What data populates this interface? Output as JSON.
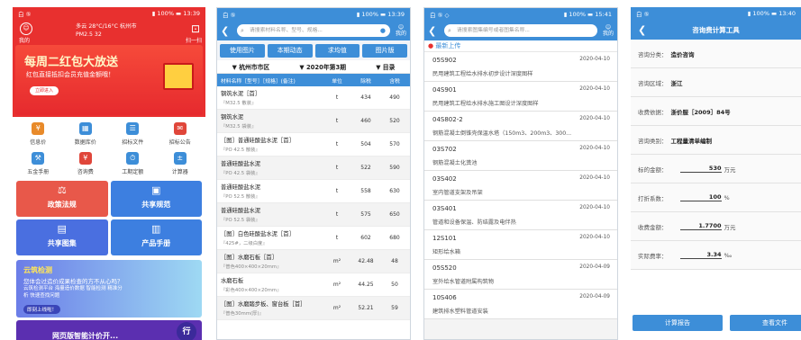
{
  "phone1": {
    "status_left": "白 ⑤",
    "status_right": "▮ 100% ▬ 13:39",
    "user_label": "我的",
    "weather": "多云 28°C/16°C  杭州市",
    "air": "PM2.5 32",
    "scan_label": "扫一扫",
    "banner_title": "每周二红包大放送",
    "banner_sub": "红包直接抵扣会员充值金额哦！",
    "banner_button": "立即进入",
    "grid": [
      {
        "label": "信息价",
        "icon": "price-info-icon",
        "color": "#e88a2a"
      },
      {
        "label": "数据库价",
        "icon": "database-icon",
        "color": "#3d8ed8"
      },
      {
        "label": "招标文件",
        "icon": "bid-file-icon",
        "color": "#3d8ed8"
      },
      {
        "label": "招标公告",
        "icon": "announcement-icon",
        "color": "#e0463a"
      },
      {
        "label": "五金手册",
        "icon": "hardware-manual-icon",
        "color": "#3d8ed8"
      },
      {
        "label": "咨询费",
        "icon": "consult-fee-icon",
        "color": "#e0463a"
      },
      {
        "label": "工期定额",
        "icon": "schedule-icon",
        "color": "#3d8ed8"
      },
      {
        "label": "计算器",
        "icon": "calculator-icon",
        "color": "#3d8ed8"
      }
    ],
    "tiles": [
      {
        "label": "政策法规",
        "color": "#e8584a"
      },
      {
        "label": "共享规范",
        "color": "#3d7fe0"
      },
      {
        "label": "共享图集",
        "color": "#4a6fe0"
      },
      {
        "label": "产品手册",
        "color": "#3d7fe0"
      }
    ],
    "ad_title": "云筑检测",
    "ad_sub": "您体会过造价成果检查的方不从心吗？",
    "ad_desc": "云筑检测平台 海量造价数据 智能检测 精准分析 快速查找问题",
    "ad_button": "即刻上线啦！",
    "ad2_text": "网页版智能计价开...",
    "fab_label": "行"
  },
  "phone2": {
    "status_left": "白 ⑤",
    "status_right": "▮ 100% ▬ 13:39",
    "search_placeholder": "请搜索材料名称、型号、规格...",
    "home_label": "我的",
    "tabs": [
      "使用图片",
      "本期动态",
      "求均值",
      "图片版"
    ],
    "filter_city": "杭州市市区",
    "filter_period": "2020年第3期",
    "filter_dir": "目录",
    "headers": [
      "材料名称［型号］［规格］(备注)",
      "单位",
      "除税",
      "含税"
    ],
    "rows": [
      {
        "name": "钢筑水泥［首］",
        "spec": "『M32.5 散装』",
        "unit": "t",
        "ex": "434",
        "inc": "490",
        "tag": true
      },
      {
        "name": "钢筑水泥",
        "spec": "『M32.5 袋装』",
        "unit": "t",
        "ex": "460",
        "inc": "520",
        "tag": false
      },
      {
        "name": "［图］普通硅酸盐水泥［首］",
        "spec": "『PO 42.5 散装』",
        "unit": "t",
        "ex": "504",
        "inc": "570",
        "tag": true
      },
      {
        "name": "普通硅酸盐水泥",
        "spec": "『PO 42.5 袋装』",
        "unit": "t",
        "ex": "522",
        "inc": "590",
        "tag": false
      },
      {
        "name": "普通硅酸盐水泥",
        "spec": "『PO 52.5 散装』",
        "unit": "t",
        "ex": "558",
        "inc": "630",
        "tag": false
      },
      {
        "name": "普通硅酸盐水泥",
        "spec": "『PO 52.5 袋装』",
        "unit": "t",
        "ex": "575",
        "inc": "650",
        "tag": false
      },
      {
        "name": "［图］白色硅酸盐水泥［首］",
        "spec": "『425#，二级白度』",
        "unit": "t",
        "ex": "602",
        "inc": "680",
        "tag": true
      },
      {
        "name": "［图］水磨石板［首］",
        "spec": "『普色400×400×20mm』",
        "unit": "m²",
        "ex": "42.48",
        "inc": "48",
        "tag": true
      },
      {
        "name": "水磨石板",
        "spec": "『彩色400×400×20mm』",
        "unit": "m²",
        "ex": "44.25",
        "inc": "50",
        "tag": false
      },
      {
        "name": "［图］水磨踏步板、窗台板［首］",
        "spec": "『普色30mm(厚)』",
        "unit": "m²",
        "ex": "52.21",
        "inc": "59",
        "tag": true
      }
    ]
  },
  "phone3": {
    "status_left": "白 ⑤ ◇",
    "status_right": "▮ 100% ▬ 15:41",
    "search_placeholder": "请搜索图集编号或者图集名称...",
    "home_label": "我的",
    "section": "最新上传",
    "items": [
      {
        "code": "05S902",
        "date": "2020-04-10",
        "title": "民用建筑工程给水排水初步设计深度图样"
      },
      {
        "code": "04S901",
        "date": "2020-04-10",
        "title": "民用建筑工程给水排水施工图设计深度图样"
      },
      {
        "code": "04S802-2",
        "date": "2020-04-10",
        "title": "钢筋混凝土倒锥壳保温水塔（150m3、200m3、300..."
      },
      {
        "code": "03S702",
        "date": "2020-04-10",
        "title": "钢筋混凝土化粪池"
      },
      {
        "code": "03S402",
        "date": "2020-04-10",
        "title": "室内管道支架及吊架"
      },
      {
        "code": "03S401",
        "date": "2020-04-10",
        "title": "管道和设备保温、防结露及电伴热"
      },
      {
        "code": "12S101",
        "date": "2020-04-10",
        "title": "矩形给水箱"
      },
      {
        "code": "05S520",
        "date": "2020-04-09",
        "title": "室外给水管道附属构筑物"
      },
      {
        "code": "10S406",
        "date": "2020-04-09",
        "title": "建筑排水塑料管道安装"
      }
    ]
  },
  "phone4": {
    "status_left": "白 ⑤",
    "status_right": "▮ 100% ▬ 13:40",
    "title": "咨询费计算工具",
    "fields": [
      {
        "label": "咨询分类：",
        "value": "造价咨询"
      },
      {
        "label": "咨询区域：",
        "value": "浙江"
      },
      {
        "label": "收费依据：",
        "value": "浙价服［2009］84号"
      },
      {
        "label": "咨询类别：",
        "value": "工程量清单编制"
      }
    ],
    "inputs": [
      {
        "label": "标的金额：",
        "value": "530",
        "unit": "万元"
      },
      {
        "label": "打折系数：",
        "value": "100",
        "unit": "%"
      },
      {
        "label": "收费金额：",
        "value": "1.7700",
        "unit": "万元"
      },
      {
        "label": "实际费率：",
        "value": "3.34",
        "unit": "‰"
      }
    ],
    "btn_calc": "计算报告",
    "btn_view": "查看文件"
  }
}
